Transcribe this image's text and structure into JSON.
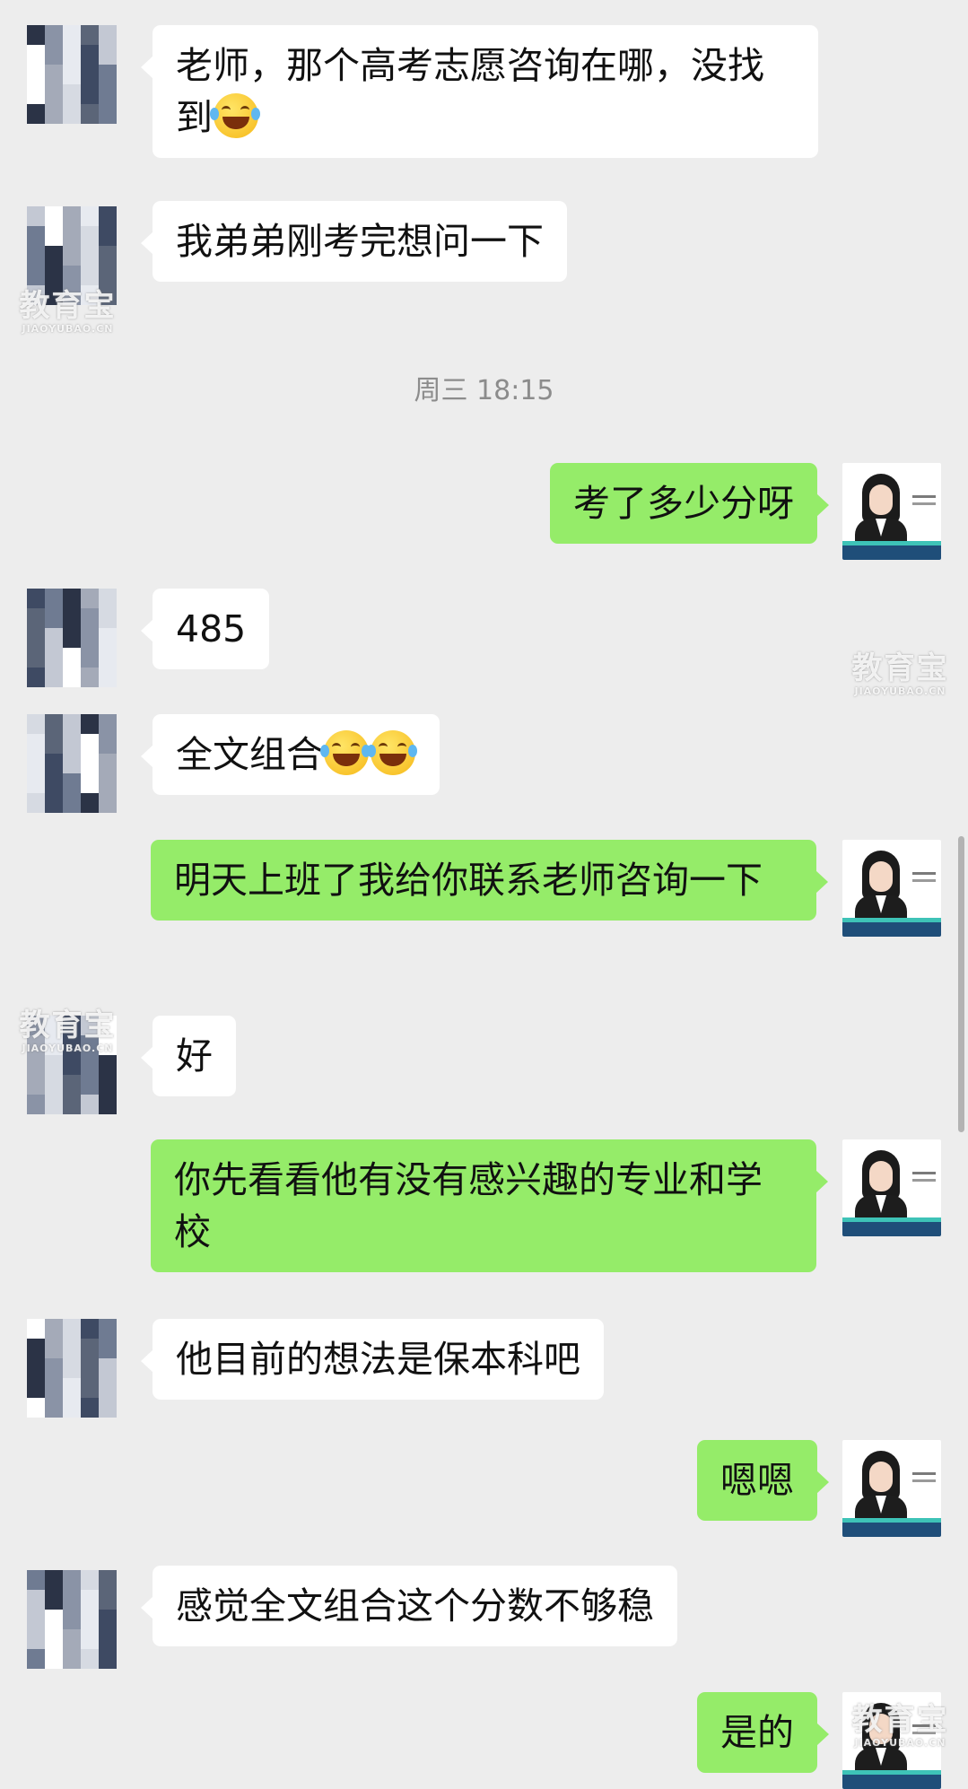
{
  "chat": {
    "timestamp": "周三 18:15",
    "messages": [
      {
        "id": "m1",
        "side": "left",
        "text": "老师，那个高考志愿咨询在哪，没找到",
        "emoji": "joy-icon"
      },
      {
        "id": "m2",
        "side": "left",
        "text": "我弟弟刚考完想问一下"
      },
      {
        "id": "m3",
        "side": "right",
        "text": "考了多少分呀"
      },
      {
        "id": "m4",
        "side": "left",
        "text": "485"
      },
      {
        "id": "m5",
        "side": "left",
        "text": "全文组合",
        "emoji": "joy-icon",
        "emoji_count": 2
      },
      {
        "id": "m6",
        "side": "right",
        "text": "明天上班了我给你联系老师咨询一下"
      },
      {
        "id": "m7",
        "side": "left",
        "text": "好"
      },
      {
        "id": "m8",
        "side": "right",
        "text": "你先看看他有没有感兴趣的专业和学校"
      },
      {
        "id": "m9",
        "side": "left",
        "text": "他目前的想法是保本科吧"
      },
      {
        "id": "m10",
        "side": "right",
        "text": "嗯嗯"
      },
      {
        "id": "m11",
        "side": "left",
        "text": "感觉全文组合这个分数不够稳"
      },
      {
        "id": "m12",
        "side": "right",
        "text": "是的"
      }
    ]
  },
  "watermark": {
    "big": "教育宝",
    "small": "JIAOYUBAO.CN"
  },
  "colors": {
    "background": "#ededed",
    "incoming_bubble": "#ffffff",
    "outgoing_bubble": "#95ec69",
    "timestamp_text": "#8c8c8c"
  }
}
